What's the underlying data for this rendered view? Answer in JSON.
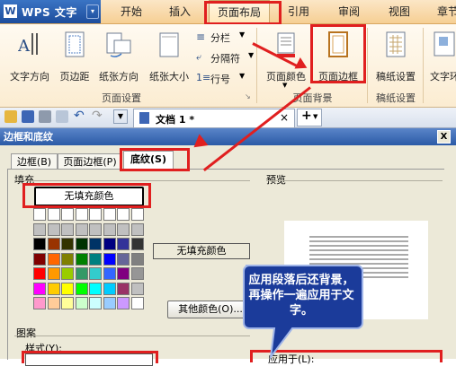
{
  "app": {
    "logo_letter": "W",
    "title": "WPS 文字",
    "menu_arrow": "▾"
  },
  "tabs": [
    "开始",
    "插入",
    "页面布局",
    "引用",
    "审阅",
    "视图",
    "章节"
  ],
  "ribbon": {
    "page_setup": {
      "buttons": [
        "文字方向",
        "页边距",
        "纸张方向",
        "纸张大小"
      ],
      "small_buttons": [
        "分栏",
        "分隔符",
        "行号"
      ],
      "group_label": "页面设置"
    },
    "page_background": {
      "buttons": [
        "页面颜色",
        "页面边框"
      ],
      "group_label": "页面背景"
    },
    "manuscript": {
      "button": "稿纸设置",
      "group_label": "稿纸设置"
    },
    "text_wrap": {
      "button": "文字环"
    }
  },
  "document_tab": {
    "name": "文档 1 *",
    "close": "×",
    "new": "+"
  },
  "dialog": {
    "title": "边框和底纹",
    "close": "X",
    "tabs": [
      "边框(B)",
      "页面边框(P)",
      "底纹(S)"
    ],
    "fill": {
      "label": "填充",
      "no_fill_button": "无填充颜色",
      "selected_display": "无填充颜色",
      "more_colors_button": "其他颜色(O)..."
    },
    "pattern": {
      "label": "图案",
      "style_label": "样式(Y):"
    },
    "preview": {
      "label": "预览"
    },
    "apply_to_label": "应用于(L):",
    "palette": [
      [
        "#ffffff",
        "#ffffff",
        "#ffffff",
        "#ffffff",
        "#ffffff",
        "#ffffff",
        "#ffffff",
        "#ffffff"
      ],
      [
        "#c0c0c0",
        "#c0c0c0",
        "#c0c0c0",
        "#c0c0c0",
        "#c0c0c0",
        "#c0c0c0",
        "#c0c0c0",
        "#c0c0c0"
      ],
      [
        "#000000",
        "#993300",
        "#333300",
        "#003300",
        "#003366",
        "#000080",
        "#333399",
        "#333333"
      ],
      [
        "#800000",
        "#ff6600",
        "#808000",
        "#008000",
        "#008080",
        "#0000ff",
        "#666699",
        "#808080"
      ],
      [
        "#ff0000",
        "#ff9900",
        "#99cc00",
        "#339966",
        "#33cccc",
        "#3366ff",
        "#800080",
        "#969696"
      ],
      [
        "#ff00ff",
        "#ffcc00",
        "#ffff00",
        "#00ff00",
        "#00ffff",
        "#00ccff",
        "#993366",
        "#c0c0c0"
      ],
      [
        "#ff99cc",
        "#ffcc99",
        "#ffff99",
        "#ccffcc",
        "#ccffff",
        "#99ccff",
        "#cc99ff",
        "#ffffff"
      ]
    ]
  },
  "callout": {
    "text": "应用段落后还背景，再操作一遍应用于文字。"
  },
  "colors": {
    "annotation_red": "#e01f1f",
    "callout_fill": "#1b3b9a",
    "dialog_bg": "#ece9d8"
  }
}
